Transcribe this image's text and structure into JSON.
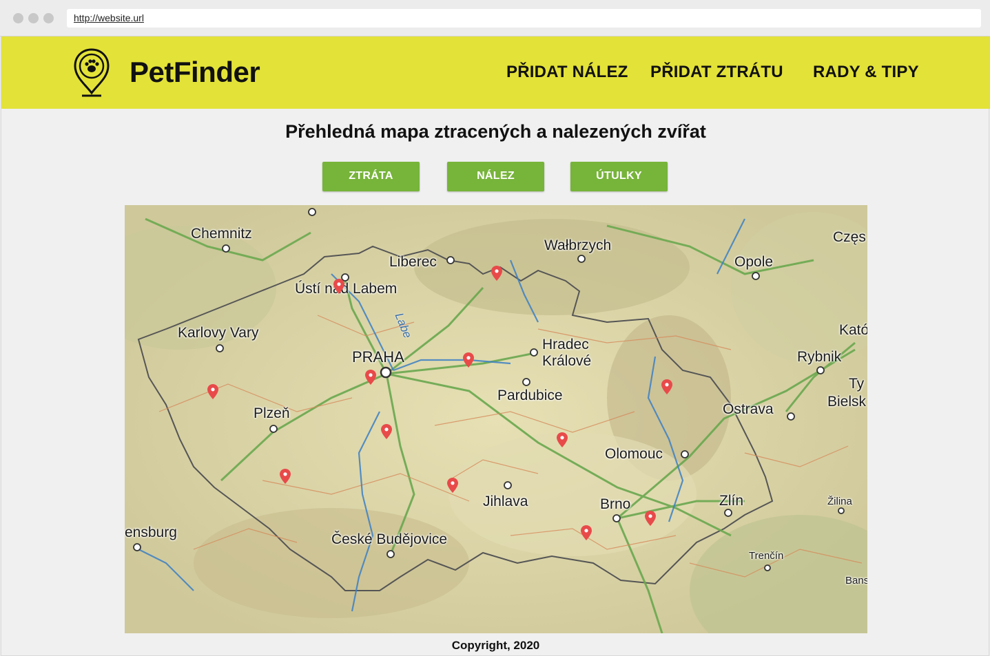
{
  "browser": {
    "url": "http://website.url"
  },
  "header": {
    "brand": "PetFinder",
    "nav": [
      "PŘIDAT NÁLEZ",
      "PŘIDAT ZTRÁTU",
      "RADY & TIPY"
    ]
  },
  "main": {
    "title": "Přehledná mapa ztracených a nalezených zvířat",
    "filters": [
      "ZTRÁTA",
      "NÁLEZ",
      "ÚTULKY"
    ]
  },
  "map": {
    "cities": [
      "Chemnitz",
      "Liberec",
      "Wałbrzych",
      "Opole",
      "Częs",
      "Ústí nad Labem",
      "Karlovy Vary",
      "PRAHA",
      "Hradec",
      "Králové",
      "Pardubice",
      "Kató",
      "Rybnik",
      "Ty",
      "Bielsk",
      "Ostrava",
      "Plzeň",
      "Olomouc",
      "Jihlava",
      "Brno",
      "Zlín",
      "Žilina",
      "ensburg",
      "České Budějovice",
      "Trenčín",
      "Bans"
    ],
    "river_label": "Labe",
    "marker_color": "#e84a4a",
    "marker_count": 12
  },
  "footer": {
    "copyright": "Copyright, 2020"
  },
  "colors": {
    "header": "#e3e238",
    "button": "#77b43a"
  }
}
